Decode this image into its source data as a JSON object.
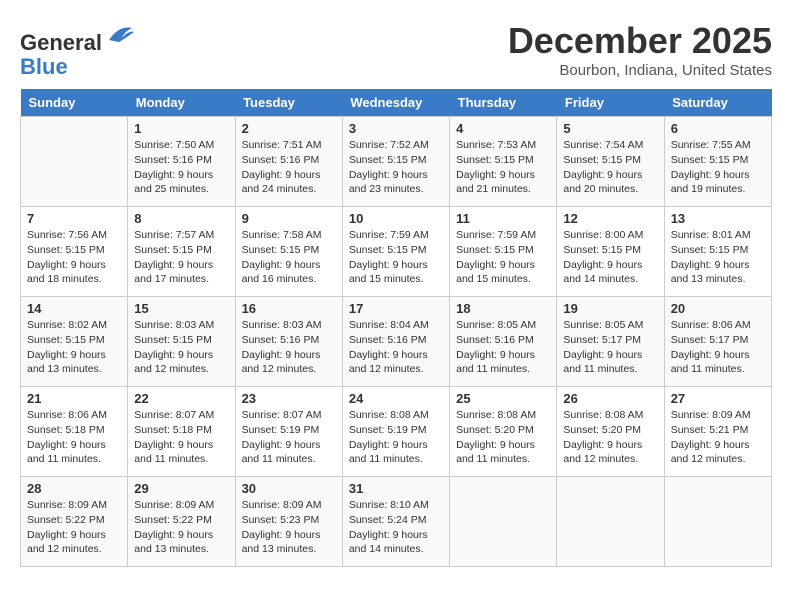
{
  "header": {
    "logo_line1": "General",
    "logo_line2": "Blue",
    "month": "December 2025",
    "location": "Bourbon, Indiana, United States"
  },
  "days_of_week": [
    "Sunday",
    "Monday",
    "Tuesday",
    "Wednesday",
    "Thursday",
    "Friday",
    "Saturday"
  ],
  "weeks": [
    [
      {
        "day": "",
        "info": ""
      },
      {
        "day": "1",
        "info": "Sunrise: 7:50 AM\nSunset: 5:16 PM\nDaylight: 9 hours\nand 25 minutes."
      },
      {
        "day": "2",
        "info": "Sunrise: 7:51 AM\nSunset: 5:16 PM\nDaylight: 9 hours\nand 24 minutes."
      },
      {
        "day": "3",
        "info": "Sunrise: 7:52 AM\nSunset: 5:15 PM\nDaylight: 9 hours\nand 23 minutes."
      },
      {
        "day": "4",
        "info": "Sunrise: 7:53 AM\nSunset: 5:15 PM\nDaylight: 9 hours\nand 21 minutes."
      },
      {
        "day": "5",
        "info": "Sunrise: 7:54 AM\nSunset: 5:15 PM\nDaylight: 9 hours\nand 20 minutes."
      },
      {
        "day": "6",
        "info": "Sunrise: 7:55 AM\nSunset: 5:15 PM\nDaylight: 9 hours\nand 19 minutes."
      }
    ],
    [
      {
        "day": "7",
        "info": "Sunrise: 7:56 AM\nSunset: 5:15 PM\nDaylight: 9 hours\nand 18 minutes."
      },
      {
        "day": "8",
        "info": "Sunrise: 7:57 AM\nSunset: 5:15 PM\nDaylight: 9 hours\nand 17 minutes."
      },
      {
        "day": "9",
        "info": "Sunrise: 7:58 AM\nSunset: 5:15 PM\nDaylight: 9 hours\nand 16 minutes."
      },
      {
        "day": "10",
        "info": "Sunrise: 7:59 AM\nSunset: 5:15 PM\nDaylight: 9 hours\nand 15 minutes."
      },
      {
        "day": "11",
        "info": "Sunrise: 7:59 AM\nSunset: 5:15 PM\nDaylight: 9 hours\nand 15 minutes."
      },
      {
        "day": "12",
        "info": "Sunrise: 8:00 AM\nSunset: 5:15 PM\nDaylight: 9 hours\nand 14 minutes."
      },
      {
        "day": "13",
        "info": "Sunrise: 8:01 AM\nSunset: 5:15 PM\nDaylight: 9 hours\nand 13 minutes."
      }
    ],
    [
      {
        "day": "14",
        "info": "Sunrise: 8:02 AM\nSunset: 5:15 PM\nDaylight: 9 hours\nand 13 minutes."
      },
      {
        "day": "15",
        "info": "Sunrise: 8:03 AM\nSunset: 5:15 PM\nDaylight: 9 hours\nand 12 minutes."
      },
      {
        "day": "16",
        "info": "Sunrise: 8:03 AM\nSunset: 5:16 PM\nDaylight: 9 hours\nand 12 minutes."
      },
      {
        "day": "17",
        "info": "Sunrise: 8:04 AM\nSunset: 5:16 PM\nDaylight: 9 hours\nand 12 minutes."
      },
      {
        "day": "18",
        "info": "Sunrise: 8:05 AM\nSunset: 5:16 PM\nDaylight: 9 hours\nand 11 minutes."
      },
      {
        "day": "19",
        "info": "Sunrise: 8:05 AM\nSunset: 5:17 PM\nDaylight: 9 hours\nand 11 minutes."
      },
      {
        "day": "20",
        "info": "Sunrise: 8:06 AM\nSunset: 5:17 PM\nDaylight: 9 hours\nand 11 minutes."
      }
    ],
    [
      {
        "day": "21",
        "info": "Sunrise: 8:06 AM\nSunset: 5:18 PM\nDaylight: 9 hours\nand 11 minutes."
      },
      {
        "day": "22",
        "info": "Sunrise: 8:07 AM\nSunset: 5:18 PM\nDaylight: 9 hours\nand 11 minutes."
      },
      {
        "day": "23",
        "info": "Sunrise: 8:07 AM\nSunset: 5:19 PM\nDaylight: 9 hours\nand 11 minutes."
      },
      {
        "day": "24",
        "info": "Sunrise: 8:08 AM\nSunset: 5:19 PM\nDaylight: 9 hours\nand 11 minutes."
      },
      {
        "day": "25",
        "info": "Sunrise: 8:08 AM\nSunset: 5:20 PM\nDaylight: 9 hours\nand 11 minutes."
      },
      {
        "day": "26",
        "info": "Sunrise: 8:08 AM\nSunset: 5:20 PM\nDaylight: 9 hours\nand 12 minutes."
      },
      {
        "day": "27",
        "info": "Sunrise: 8:09 AM\nSunset: 5:21 PM\nDaylight: 9 hours\nand 12 minutes."
      }
    ],
    [
      {
        "day": "28",
        "info": "Sunrise: 8:09 AM\nSunset: 5:22 PM\nDaylight: 9 hours\nand 12 minutes."
      },
      {
        "day": "29",
        "info": "Sunrise: 8:09 AM\nSunset: 5:22 PM\nDaylight: 9 hours\nand 13 minutes."
      },
      {
        "day": "30",
        "info": "Sunrise: 8:09 AM\nSunset: 5:23 PM\nDaylight: 9 hours\nand 13 minutes."
      },
      {
        "day": "31",
        "info": "Sunrise: 8:10 AM\nSunset: 5:24 PM\nDaylight: 9 hours\nand 14 minutes."
      },
      {
        "day": "",
        "info": ""
      },
      {
        "day": "",
        "info": ""
      },
      {
        "day": "",
        "info": ""
      }
    ]
  ]
}
